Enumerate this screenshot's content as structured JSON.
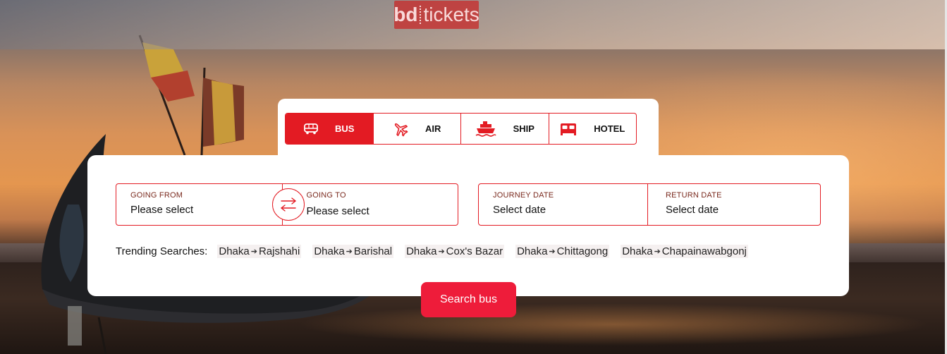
{
  "brand": {
    "logo_bd": "bd",
    "logo_tickets": "tickets"
  },
  "tabs": [
    {
      "label": "BUS",
      "icon": "bus-icon",
      "active": true
    },
    {
      "label": "AIR",
      "icon": "airplane-icon",
      "active": false
    },
    {
      "label": "SHIP",
      "icon": "ship-icon",
      "active": false
    },
    {
      "label": "HOTEL",
      "icon": "bed-icon",
      "active": false
    }
  ],
  "route": {
    "from_label": "GOING FROM",
    "from_value": "Please select",
    "to_label": "GOING TO",
    "to_value": "Please select"
  },
  "dates": {
    "journey_label": "JOURNEY DATE",
    "journey_value": "Select date",
    "return_label": "RETURN DATE",
    "return_value": "Select date"
  },
  "trending": {
    "label": "Trending Searches:",
    "items": [
      {
        "from": "Dhaka",
        "to": "Rajshahi"
      },
      {
        "from": "Dhaka",
        "to": "Barishal"
      },
      {
        "from": "Dhaka",
        "to": "Cox's Bazar"
      },
      {
        "from": "Dhaka",
        "to": "Chittagong"
      },
      {
        "from": "Dhaka",
        "to": "Chapainawabgonj"
      }
    ]
  },
  "search_button": "Search bus",
  "colors": {
    "accent": "#e31b23",
    "button": "#ee1c3a"
  }
}
